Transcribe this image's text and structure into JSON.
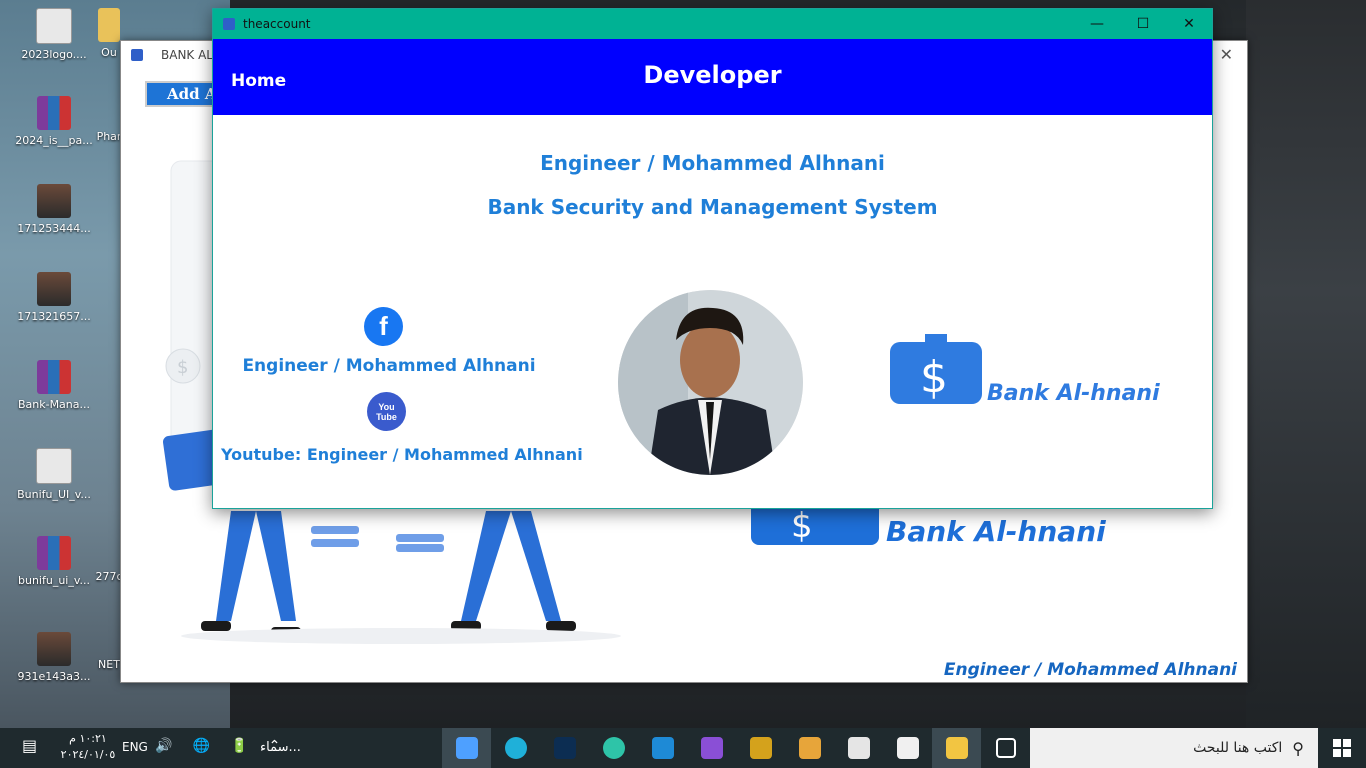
{
  "desktop": {
    "icons": [
      {
        "label": "2023logo...."
      },
      {
        "label": "Ou"
      },
      {
        "label": "2024_is__pa..."
      },
      {
        "label": "Phar"
      },
      {
        "label": "171253444..."
      },
      {
        "label": "171321657..."
      },
      {
        "label": "Bank-Mana..."
      },
      {
        "label": "Bunifu_UI_v..."
      },
      {
        "label": "bunifu_ui_v..."
      },
      {
        "label": "277c"
      },
      {
        "label": "931e143a3..."
      },
      {
        "label": "NET"
      }
    ]
  },
  "back_window": {
    "title": "BANK ALHN",
    "add_button_label": "Add Acc",
    "brand_text": "Bank Al-hnani",
    "footer_text": "Engineer / Mohammed Alhnani",
    "close_glyph": "✕"
  },
  "front_window": {
    "title": "theaccount",
    "controls": {
      "minimize": "—",
      "maximize": "☐",
      "close": "✕"
    },
    "header": {
      "home_label": "Home",
      "title": "Developer"
    },
    "line1": "Engineer / Mohammed Alhnani",
    "line2": "Bank Security and Management System",
    "facebook": {
      "icon": "facebook-icon",
      "glyph": "f",
      "text": "Engineer / Mohammed Alhnani"
    },
    "youtube": {
      "icon": "youtube-icon",
      "glyph_top": "You",
      "glyph_bottom": "Tube",
      "text": "Youtube: Engineer / Mohammed Alhnani"
    },
    "brand_text": "Bank Al-hnani"
  },
  "taskbar": {
    "search_placeholder": "اكتب هنا للبحث",
    "time": "١٠:٢١ م",
    "date": "٢٠٢٤/٠١/٠٥",
    "language": "ENG",
    "news": "سماء..."
  },
  "colors": {
    "header_blue": "#0000ff",
    "title_green": "#00b294",
    "text_blue": "#1f7fd8"
  }
}
